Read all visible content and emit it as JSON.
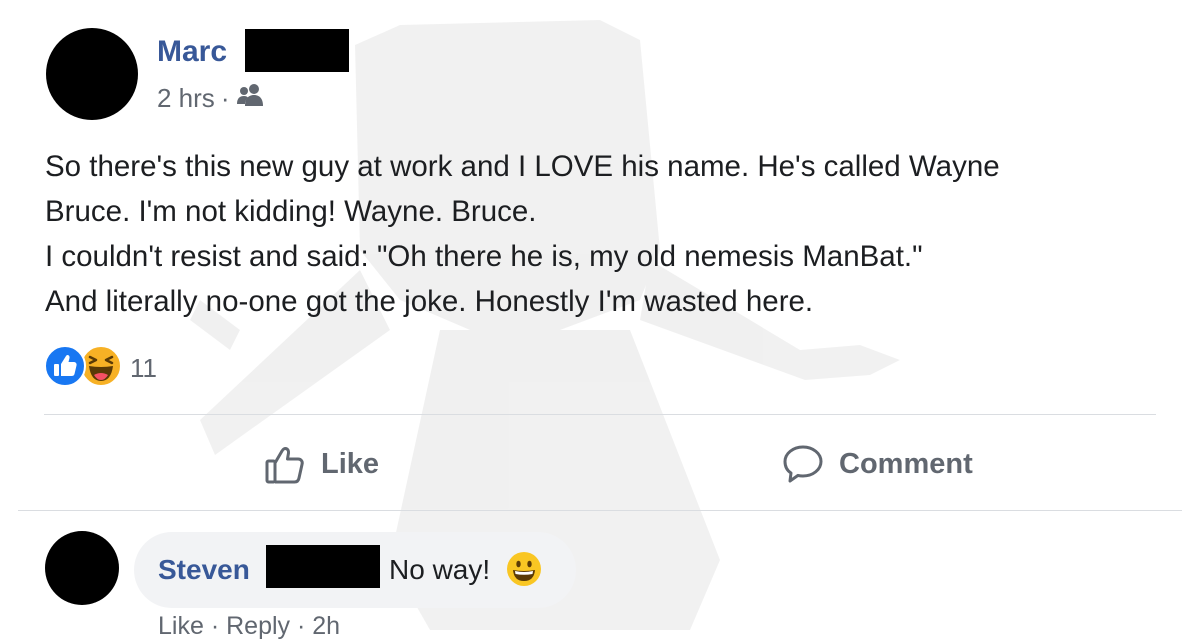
{
  "post": {
    "author_name": "Marc",
    "timestamp": "2 hrs",
    "separator": "·",
    "audience_icon": "friends-icon",
    "lines": [
      "So there's this new guy at work and I LOVE his name. He's called Wayne",
      "Bruce. I'm not kidding! Wayne. Bruce.",
      "I couldn't resist and said: \"Oh there he is, my old nemesis ManBat.\"",
      "And literally no-one got the joke. Honestly I'm wasted here."
    ],
    "reactions": {
      "icons": [
        "like-reaction-icon",
        "haha-reaction-icon"
      ],
      "count": "11"
    }
  },
  "actions": {
    "like_label": "Like",
    "comment_label": "Comment"
  },
  "comment": {
    "author_name": "Steven",
    "text": "No way!",
    "emoji": "grinning-face-icon",
    "like_label": "Like",
    "reply_label": "Reply",
    "time": "2h",
    "separator": "·"
  },
  "colors": {
    "name_blue": "#385898",
    "secondary_text": "#616770",
    "like_blue": "#1877f2",
    "haha_yellow": "#f7b125",
    "bubble_bg": "#f2f3f5",
    "divider": "#dadde1"
  }
}
